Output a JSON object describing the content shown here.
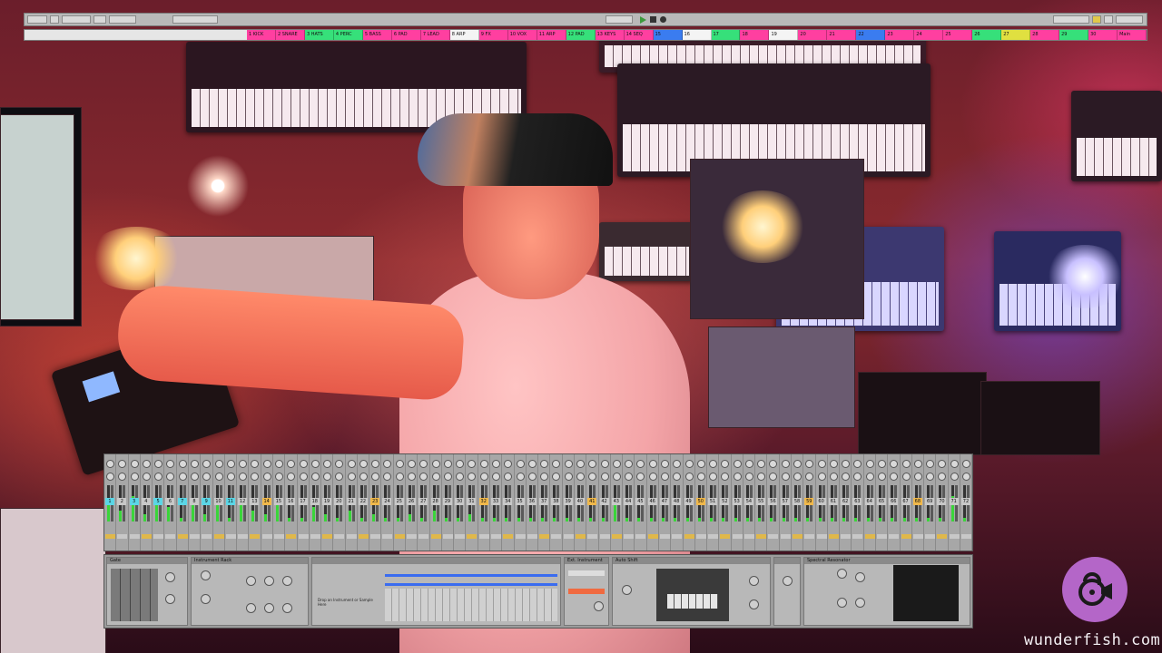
{
  "watermark": {
    "text": "wunderfish.com",
    "icon": "fish-lock-icon"
  },
  "daw": {
    "scene_name": "",
    "clips": [
      {
        "label": "1 KICK",
        "color": "#ff3fa0"
      },
      {
        "label": "2 SNARE",
        "color": "#ff3fa0"
      },
      {
        "label": "3 HATS",
        "color": "#36e07a"
      },
      {
        "label": "4 PERC",
        "color": "#36e07a"
      },
      {
        "label": "5 BASS",
        "color": "#ff3fa0"
      },
      {
        "label": "6 PAD",
        "color": "#ff3fa0"
      },
      {
        "label": "7 LEAD",
        "color": "#ff3fa0"
      },
      {
        "label": "8 ARP",
        "color": "#f4f4f4"
      },
      {
        "label": "9 FX",
        "color": "#ff3fa0"
      },
      {
        "label": "10 VOX",
        "color": "#ff3fa0"
      },
      {
        "label": "11 ARP",
        "color": "#ff3fa0"
      },
      {
        "label": "12 PAD",
        "color": "#36e07a"
      },
      {
        "label": "13 KEYS",
        "color": "#ff3fa0"
      },
      {
        "label": "14 SEQ",
        "color": "#ff3fa0"
      },
      {
        "label": "15",
        "color": "#3a7cf0"
      },
      {
        "label": "16",
        "color": "#f4f4f4"
      },
      {
        "label": "17",
        "color": "#36e07a"
      },
      {
        "label": "18",
        "color": "#ff3fa0"
      },
      {
        "label": "19",
        "color": "#f4f4f4"
      },
      {
        "label": "20",
        "color": "#ff3fa0"
      },
      {
        "label": "21",
        "color": "#ff3fa0"
      },
      {
        "label": "22",
        "color": "#3a7cf0"
      },
      {
        "label": "23",
        "color": "#ff3fa0"
      },
      {
        "label": "24",
        "color": "#ff3fa0"
      },
      {
        "label": "25",
        "color": "#ff3fa0"
      },
      {
        "label": "26",
        "color": "#36e07a"
      },
      {
        "label": "27",
        "color": "#e0e040"
      },
      {
        "label": "28",
        "color": "#ff3fa0"
      },
      {
        "label": "29",
        "color": "#36e07a"
      },
      {
        "label": "30",
        "color": "#ff3fa0"
      },
      {
        "label": "Main",
        "color": "#ff3fa0"
      }
    ],
    "devices": [
      {
        "title": "Gate"
      },
      {
        "title": "Instrument Rack"
      },
      {
        "title": ""
      },
      {
        "title": "Ext. Instrument"
      },
      {
        "title": "Auto Shift"
      },
      {
        "title": ""
      },
      {
        "title": "Spectral Resonator"
      }
    ],
    "device_chain_hint": "Drop an Instrument or Sample Here"
  },
  "mixer": {
    "track_numbers": [
      "1",
      "2",
      "3",
      "4",
      "5",
      "6",
      "7",
      "8",
      "9",
      "10",
      "11",
      "12",
      "13",
      "14",
      "15",
      "16",
      "17",
      "18",
      "19",
      "20",
      "21",
      "22",
      "23",
      "24",
      "25",
      "26",
      "27",
      "28",
      "29",
      "30",
      "31",
      "32",
      "33",
      "34",
      "35",
      "36",
      "37",
      "38",
      "39",
      "40",
      "41",
      "42",
      "43",
      "44",
      "45",
      "46",
      "47",
      "48",
      "49",
      "50",
      "51",
      "52",
      "53",
      "54",
      "55",
      "56",
      "57",
      "58",
      "59",
      "60",
      "61",
      "62",
      "63",
      "64",
      "65",
      "66",
      "67",
      "68",
      "69",
      "70",
      "71",
      "72"
    ],
    "meter_levels": [
      0.6,
      0.3,
      0.7,
      0.2,
      0.55,
      0.4,
      0.1,
      0.65,
      0.2,
      0.45,
      0.1,
      0.6,
      0.3,
      0.2,
      0.5,
      0.1,
      0.1,
      0.4,
      0.2,
      0.1,
      0.3,
      0.1,
      0.2,
      0.1,
      0.1,
      0.2,
      0.1,
      0.3,
      0.1,
      0.1,
      0.2,
      0.1,
      0.1,
      0.1,
      0.1,
      0.1,
      0.1,
      0.1,
      0.1,
      0.1,
      0.1,
      0.1,
      0.5,
      0.1,
      0.1,
      0.1,
      0.1,
      0.1,
      0.1,
      0.1,
      0.1,
      0.1,
      0.1,
      0.1,
      0.1,
      0.1,
      0.1,
      0.1,
      0.1,
      0.1,
      0.1,
      0.1,
      0.1,
      0.1,
      0.1,
      0.1,
      0.1,
      0.1,
      0.1,
      0.1,
      0.7,
      0.1
    ]
  }
}
